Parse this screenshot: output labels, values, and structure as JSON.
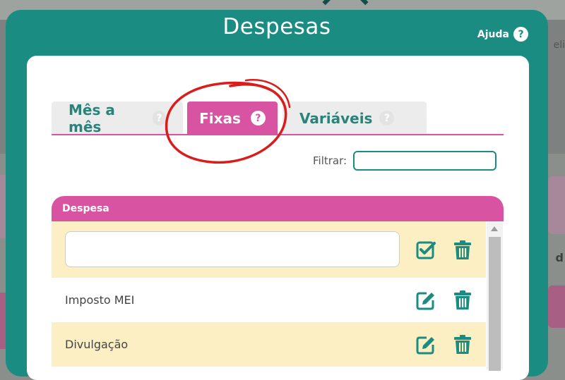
{
  "modal": {
    "title": "Despesas",
    "help_label": "Ajuda",
    "help_badge": "?"
  },
  "tabs": [
    {
      "label": "Mês a mês",
      "badge": "?"
    },
    {
      "label": "Fixas",
      "badge": "?",
      "active": true
    },
    {
      "label": "Variáveis",
      "badge": "?"
    }
  ],
  "filter": {
    "label": "Filtrar:",
    "value": ""
  },
  "table": {
    "header": "Despesa",
    "new_row_value": "",
    "rows": [
      {
        "name": "Imposto MEI"
      },
      {
        "name": "Divulgação"
      }
    ]
  },
  "background": {
    "right_text": "d",
    "right_top_text": "eli"
  },
  "colors": {
    "teal": "#1a8c82",
    "pink": "#d853a1",
    "row_yellow": "#fbefc3",
    "annotation_red": "#d91c1c"
  },
  "icons": {
    "confirm": "check-square-icon",
    "edit": "edit-icon",
    "delete": "trash-icon",
    "help": "question-circle-icon"
  }
}
